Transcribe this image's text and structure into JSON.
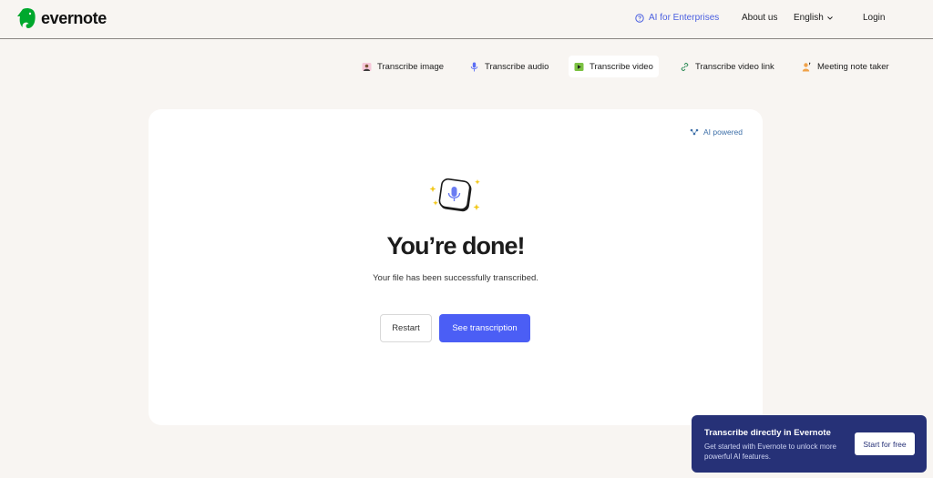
{
  "header": {
    "logo_text": "evernote",
    "nav_ai": "AI for Enterprises",
    "nav_about": "About us",
    "nav_language": "English",
    "nav_login": "Login"
  },
  "tabs": [
    {
      "label": "Transcribe image",
      "icon": "image-icon"
    },
    {
      "label": "Transcribe audio",
      "icon": "microphone-icon"
    },
    {
      "label": "Transcribe video",
      "icon": "video-icon",
      "active": true
    },
    {
      "label": "Transcribe video link",
      "icon": "link-icon"
    },
    {
      "label": "Meeting note taker",
      "icon": "person-icon"
    }
  ],
  "card": {
    "ai_powered": "AI powered",
    "title": "You’re done!",
    "subtitle": "Your file has been successfully transcribed.",
    "restart_label": "Restart",
    "see_label": "See transcription"
  },
  "promo": {
    "title": "Transcribe directly in Evernote",
    "text": "Get started with Evernote to unlock more powerful AI features.",
    "button_label": "Start for free"
  },
  "colors": {
    "background": "#f8f5f2",
    "accent": "#4b5ef5",
    "link": "#4a5fe0",
    "promo_bg": "#263177",
    "brand_green": "#00a82d"
  }
}
